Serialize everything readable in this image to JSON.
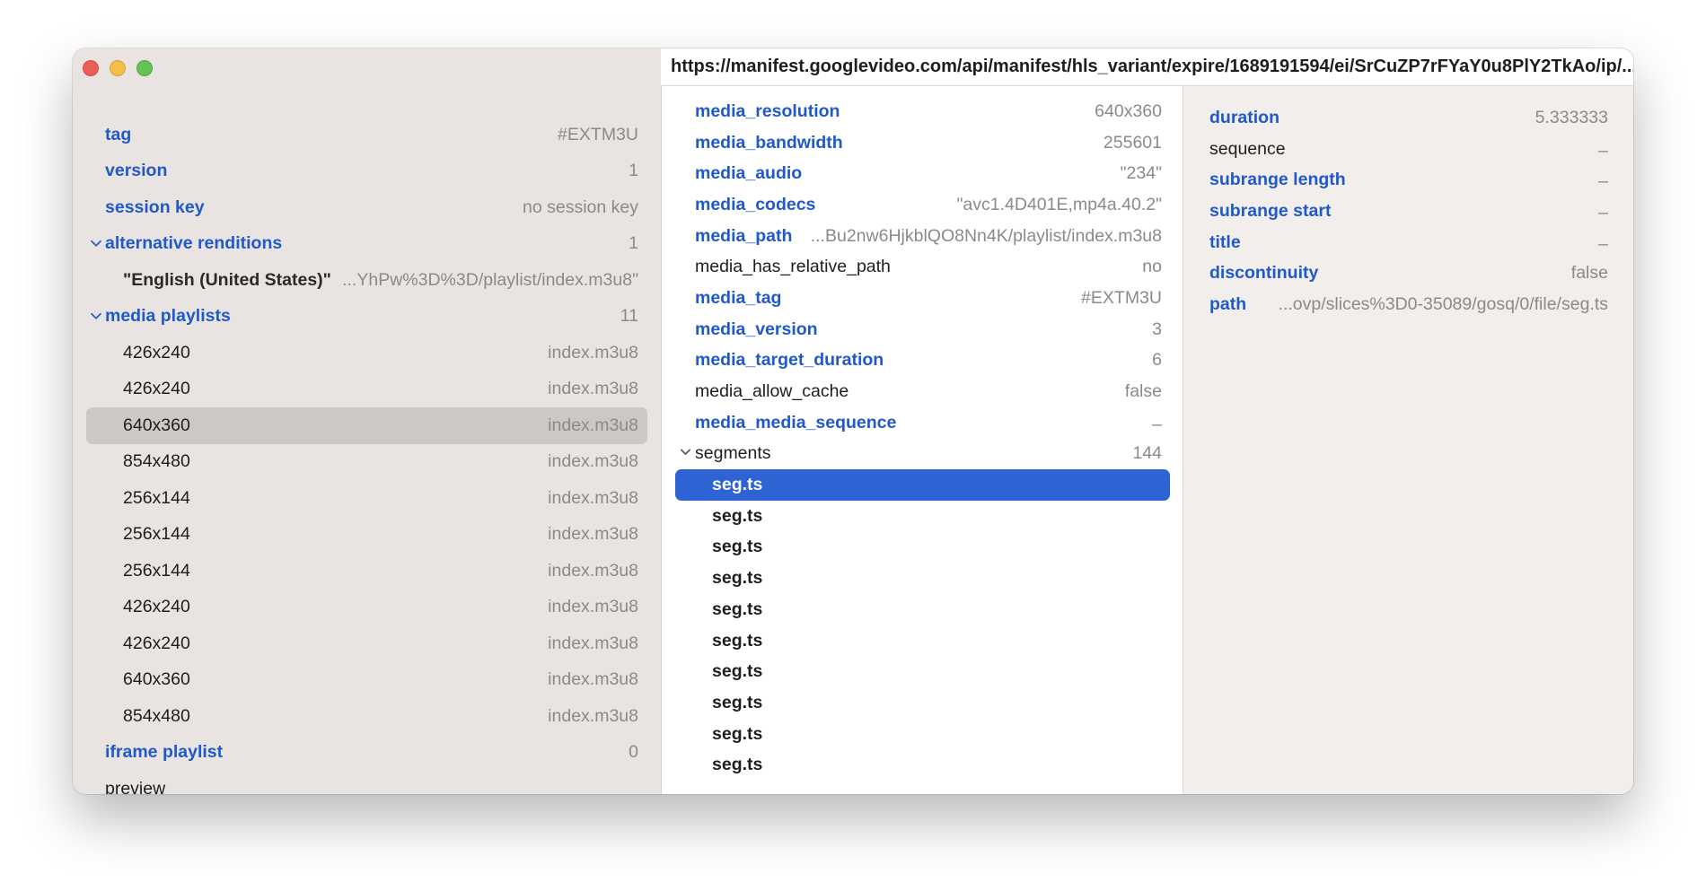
{
  "window": {
    "url": "https://manifest.googlevideo.com/api/manifest/hls_variant/expire/1689191594/ei/SrCuZP7rFYaY0u8PlY2TkAo/ip/..."
  },
  "sidebar": {
    "rows": [
      {
        "label": "tag",
        "value": "#EXTM3U"
      },
      {
        "label": "version",
        "value": "1"
      },
      {
        "label": "session key",
        "value": "no session key"
      },
      {
        "label": "alternative renditions",
        "value": "1"
      },
      {
        "label": "\"English (United States)\"",
        "value": "...YhPw%3D%3D/playlist/index.m3u8\""
      },
      {
        "label": "media playlists",
        "value": "11"
      },
      {
        "label": "426x240",
        "value": "index.m3u8"
      },
      {
        "label": "426x240",
        "value": "index.m3u8"
      },
      {
        "label": "640x360",
        "value": "index.m3u8"
      },
      {
        "label": "854x480",
        "value": "index.m3u8"
      },
      {
        "label": "256x144",
        "value": "index.m3u8"
      },
      {
        "label": "256x144",
        "value": "index.m3u8"
      },
      {
        "label": "256x144",
        "value": "index.m3u8"
      },
      {
        "label": "426x240",
        "value": "index.m3u8"
      },
      {
        "label": "426x240",
        "value": "index.m3u8"
      },
      {
        "label": "640x360",
        "value": "index.m3u8"
      },
      {
        "label": "854x480",
        "value": "index.m3u8"
      },
      {
        "label": "iframe playlist",
        "value": "0"
      },
      {
        "label": "preview",
        "value": ""
      }
    ]
  },
  "middle": {
    "rows": [
      {
        "label": "media_resolution",
        "value": "640x360"
      },
      {
        "label": "media_bandwidth",
        "value": "255601"
      },
      {
        "label": "media_audio",
        "value": "\"234\""
      },
      {
        "label": "media_codecs",
        "value": "\"avc1.4D401E,mp4a.40.2\""
      },
      {
        "label": "media_path",
        "value": "...Bu2nw6HjkblQO8Nn4K/playlist/index.m3u8"
      },
      {
        "label": "media_has_relative_path",
        "value": "no"
      },
      {
        "label": "media_tag",
        "value": "#EXTM3U"
      },
      {
        "label": "media_version",
        "value": "3"
      },
      {
        "label": "media_target_duration",
        "value": "6"
      },
      {
        "label": "media_allow_cache",
        "value": "false"
      },
      {
        "label": "media_media_sequence",
        "value": "–"
      },
      {
        "label": "segments",
        "value": "144"
      }
    ],
    "segments": [
      "seg.ts",
      "seg.ts",
      "seg.ts",
      "seg.ts",
      "seg.ts",
      "seg.ts",
      "seg.ts",
      "seg.ts",
      "seg.ts",
      "seg.ts"
    ]
  },
  "details": {
    "rows": [
      {
        "label": "duration",
        "value": "5.333333"
      },
      {
        "label": "sequence",
        "value": "–"
      },
      {
        "label": "subrange length",
        "value": "–"
      },
      {
        "label": "subrange start",
        "value": "–"
      },
      {
        "label": "title",
        "value": "–"
      },
      {
        "label": "discontinuity",
        "value": "false"
      },
      {
        "label": "path",
        "value": "...ovp/slices%3D0-35089/gosq/0/file/seg.ts"
      }
    ]
  }
}
